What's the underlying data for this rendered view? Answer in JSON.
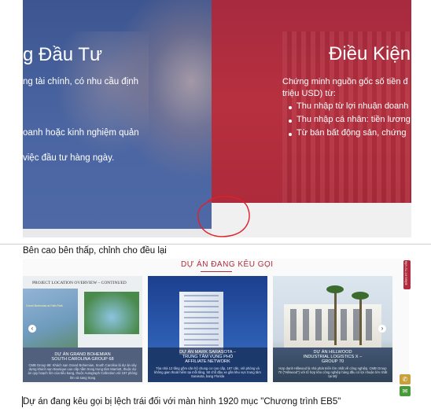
{
  "top_screenshot": {
    "left_panel": {
      "heading": "g Đầu Tư",
      "lines": [
        "ng tài chính, có nhu cầu định",
        "",
        "oanh hoặc kinh nghiệm quản",
        "",
        " việc đầu tư hàng ngày."
      ]
    },
    "right_panel": {
      "heading": "Điều Kiện",
      "intro_lines": [
        "Chứng minh nguồn gốc số tiền đ",
        "triệu USD) từ:"
      ],
      "bullets": [
        "Thu nhập từ lợi nhuận doanh",
        "Thu nhập cá nhân: tiền lương",
        "Từ bán bất động sản, chứng"
      ]
    },
    "colors": {
      "left_bg": "#4a65a2",
      "right_bg": "#b7303f",
      "annotation": "#e0202a"
    }
  },
  "note_1": "Bên cao bên thấp, chỉnh cho đều lại",
  "bottom_screenshot": {
    "section_title": "DỰ ÁN ĐANG KÊU GỌI",
    "side_tab": "ĐĂNG KÝ TƯ VẤN",
    "cards": [
      {
        "header": "PROJECT LOCATION OVERVIEW – CONTINUED",
        "map_label": "Grand Bohemian at Falls Park",
        "title_lines": [
          "DỰ ÁN GRAND BOHEMIAN",
          "SOUTH CAROLINA GROUP 68"
        ],
        "desc": "CMB Group 68: Khách sạn Grand Bohemian, South Carolina là dự án xây dựng khách sạn Boutique cao cấp nằm trong trung tâm Marriott, thuộc dự án quy hoạch lớn của tiểu bang, thuộc Autograph Collection với 197 phòng lớn và sang trọng"
      },
      {
        "title_lines": [
          "DỰ ÁN MARK SARASOTA –",
          "TRUNG TÂM VỤNG PHỎ",
          "AFFILIATE NETWORK"
        ],
        "desc": "Tòa nhà 12 tầng gồm căn hộ chung cư cao cấp, 187 căn, với phòng và không gian thoát hiểm tại mỗi tầng, 50 chỗ đậu xe gần khu vực trung tâm Sarasota, bang Florida"
      },
      {
        "title_lines": [
          "DỰ ÁN HILLWOOD",
          "INDUSTRIAL LOGISTICS X –",
          "GROUP 70"
        ],
        "desc": "Hợp danh Hillwood là nhà phát triển lớn nhất về công nghiệp, CMB Group 70 (\"Hillwood\") với tổ hợp kho công nghiệp hàng đầu có lợi nhuận lớn nhất tại Mỹ"
      }
    ],
    "icons": [
      "chevron-left-icon",
      "chevron-right-icon",
      "phone-icon",
      "mail-icon"
    ]
  },
  "note_2": "Dự án đang kêu gọi bị lệch trái đối với màn hình 1920 mục \"Chương trình EB5\""
}
